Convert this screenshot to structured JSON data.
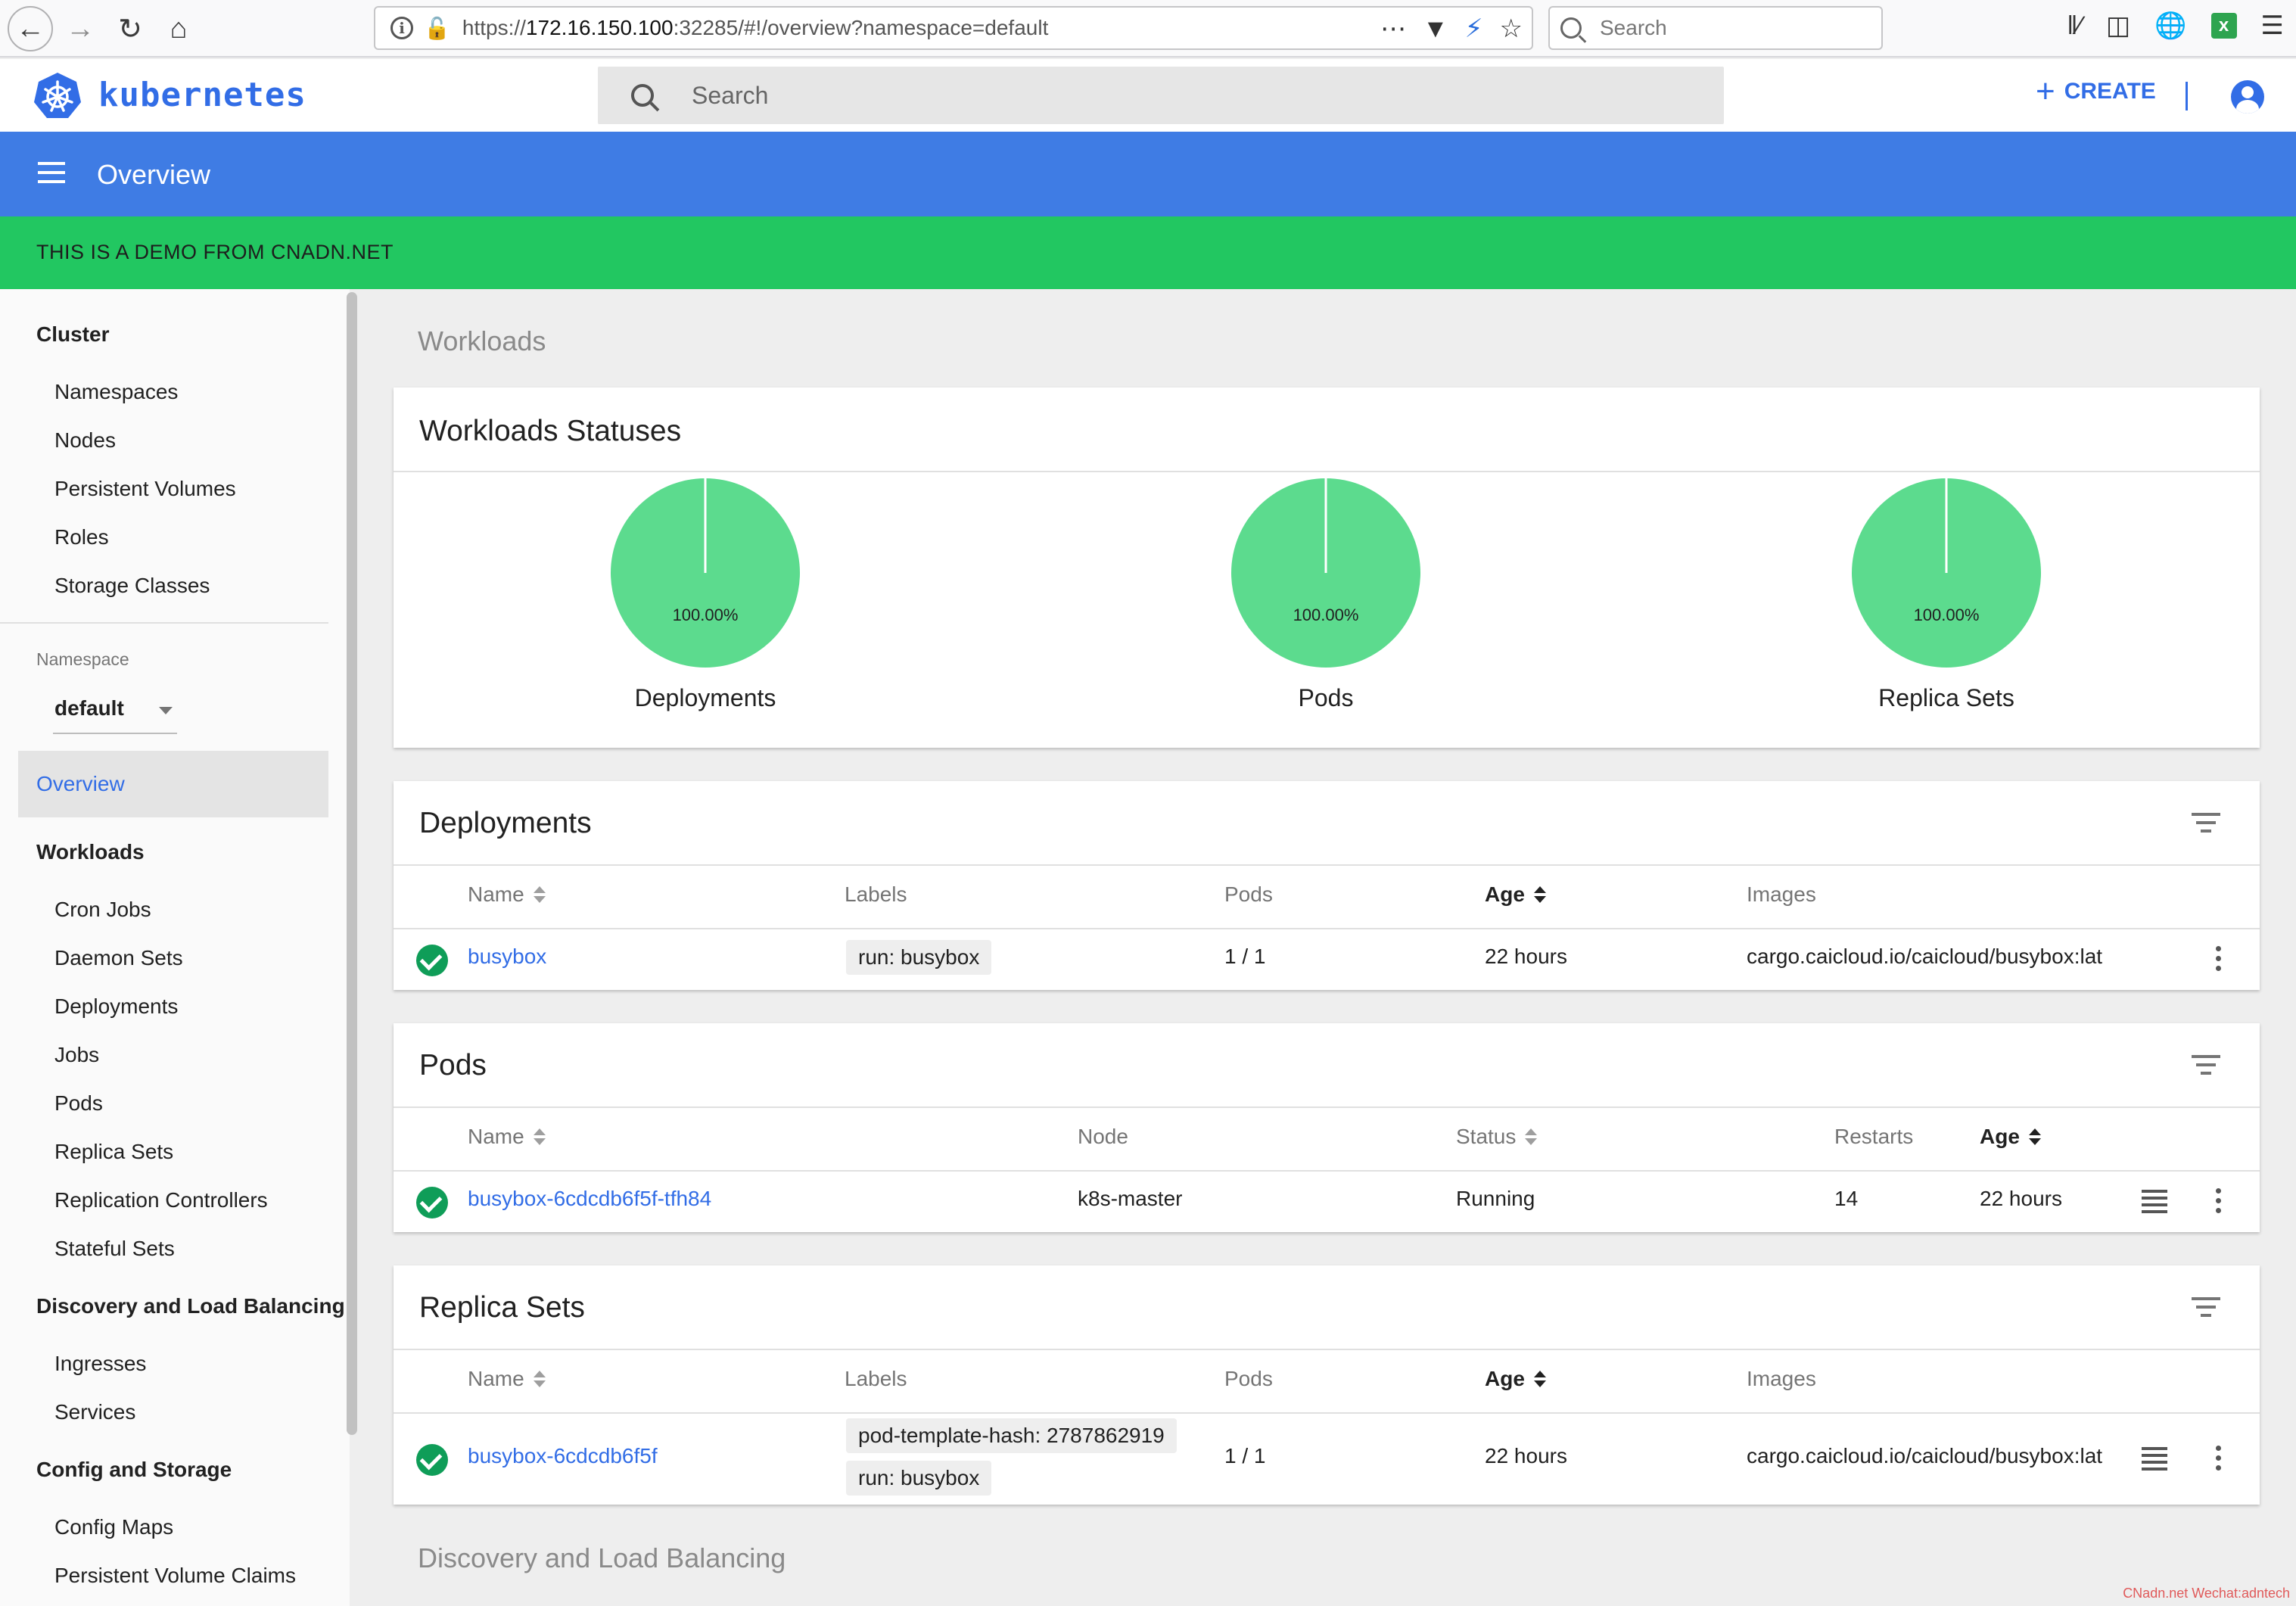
{
  "browser": {
    "url_prefix": "https://",
    "url_host": "172.16.150.100",
    "url_rest": ":32285/#!/overview?namespace=default",
    "search_placeholder": "Search"
  },
  "app": {
    "brand": "kubernetes",
    "search_placeholder": "Search",
    "create_label": "CREATE",
    "page_title": "Overview",
    "banner": "THIS IS A DEMO FROM CNADN.NET"
  },
  "sidebar": {
    "cluster_heading": "Cluster",
    "cluster_items": [
      "Namespaces",
      "Nodes",
      "Persistent Volumes",
      "Roles",
      "Storage Classes"
    ],
    "namespace_label": "Namespace",
    "namespace_value": "default",
    "active_item": "Overview",
    "workloads_heading": "Workloads",
    "workloads_items": [
      "Cron Jobs",
      "Daemon Sets",
      "Deployments",
      "Jobs",
      "Pods",
      "Replica Sets",
      "Replication Controllers",
      "Stateful Sets"
    ],
    "discovery_heading": "Discovery and Load Balancing",
    "discovery_items": [
      "Ingresses",
      "Services"
    ],
    "config_heading": "Config and Storage",
    "config_items": [
      "Config Maps",
      "Persistent Volume Claims"
    ]
  },
  "main": {
    "workloads_section": "Workloads",
    "discovery_section": "Discovery and Load Balancing",
    "statuses": {
      "title": "Workloads Statuses",
      "charts": [
        {
          "label": "Deployments",
          "percent_text": "100.00%",
          "running_fraction": 1.0
        },
        {
          "label": "Pods",
          "percent_text": "100.00%",
          "running_fraction": 1.0
        },
        {
          "label": "Replica Sets",
          "percent_text": "100.00%",
          "running_fraction": 1.0
        }
      ]
    },
    "deployments": {
      "title": "Deployments",
      "headers": {
        "name": "Name",
        "labels": "Labels",
        "pods": "Pods",
        "age": "Age",
        "images": "Images"
      },
      "rows": [
        {
          "name": "busybox",
          "label": "run: busybox",
          "pods": "1 / 1",
          "age": "22 hours",
          "image": "cargo.caicloud.io/caicloud/busybox:latest"
        }
      ]
    },
    "pods": {
      "title": "Pods",
      "headers": {
        "name": "Name",
        "node": "Node",
        "status": "Status",
        "restarts": "Restarts",
        "age": "Age"
      },
      "rows": [
        {
          "name": "busybox-6cdcdb6f5f-tfh84",
          "node": "k8s-master",
          "status": "Running",
          "restarts": "14",
          "age": "22 hours"
        }
      ]
    },
    "replica_sets": {
      "title": "Replica Sets",
      "headers": {
        "name": "Name",
        "labels": "Labels",
        "pods": "Pods",
        "age": "Age",
        "images": "Images"
      },
      "rows": [
        {
          "name": "busybox-6cdcdb6f5f",
          "label1": "pod-template-hash: 2787862919",
          "label2": "run: busybox",
          "pods": "1 / 1",
          "age": "22 hours",
          "image": "cargo.caicloud.io/caicloud/busybox:latest"
        }
      ]
    }
  },
  "colors": {
    "accent": "#326de6",
    "titlebar": "#3f7ce4",
    "banner": "#22c761",
    "pie": "#5cdb8e",
    "ok": "#0f9d58"
  },
  "watermark": "CNadn.net Wechat:adntech"
}
